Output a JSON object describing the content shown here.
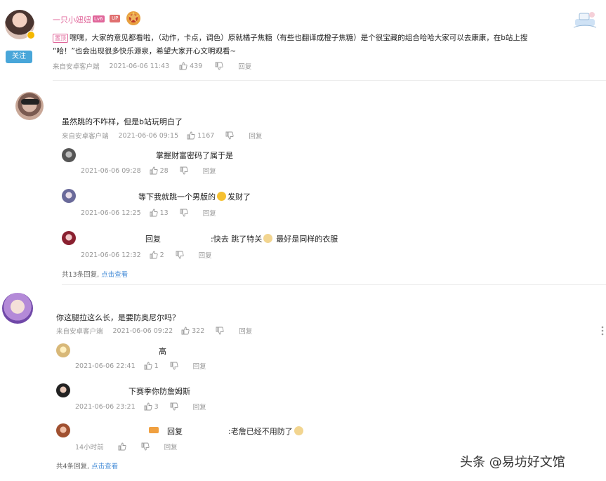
{
  "main": {
    "username": "一只小妞妞",
    "level_badge": "Lv6",
    "up_badge": "UP",
    "follow_label": "关注",
    "pinned_tag": "置顶",
    "content_line1": "嘿嘿，大家的意见都看啦，（动作，卡点，调色）原就橘子焦糖（有些也翻译成橙子焦糖）是个很宝藏的组合哈哈大家可以去康康，在b站上搜",
    "content_line2": "“哈！”也会出现很多快乐源泉，希望大家开心文明观看~",
    "source": "来自安卓客户端",
    "time": "2021-06-06 11:43",
    "likes": "439",
    "reply_label": "回复"
  },
  "comment1": {
    "text": "虽然跳的不咋样，但是b站玩明白了",
    "source": "来自安卓客户端",
    "time": "2021-06-06 09:15",
    "likes": "1167",
    "reply_label": "回复",
    "replies": [
      {
        "text": "掌握财富密码了属于是",
        "time": "2021-06-06 09:28",
        "likes": "28",
        "reply_label": "回复"
      },
      {
        "text_a": "等下我就跳一个男版的",
        "text_b": "发财了",
        "time": "2021-06-06 12:25",
        "likes": "13",
        "reply_label": "回复"
      },
      {
        "prefix": "回复",
        "text_a": ":快去  跳了特关",
        "text_b": "最好是同样的衣服",
        "time": "2021-06-06 12:32",
        "likes": "2",
        "reply_label": "回复"
      }
    ],
    "more_count": "共13条回复,",
    "more_link": "点击查看"
  },
  "comment2": {
    "text": "你这腿拉这么长，是要防奥尼尔吗？",
    "source": "来自安卓客户端",
    "time": "2021-06-06 09:22",
    "likes": "322",
    "reply_label": "回复",
    "replies": [
      {
        "text": "高",
        "time": "2021-06-06 22:41",
        "likes": "1",
        "reply_label": "回复"
      },
      {
        "text": "下赛季你防詹姆斯",
        "time": "2021-06-06 23:21",
        "likes": "3",
        "reply_label": "回复"
      },
      {
        "prefix": "回复",
        "text_a": ":老詹已经不用防了",
        "time": "14小时前",
        "reply_label": "回复"
      }
    ],
    "more_count": "共4条回复,",
    "more_link": "点击查看"
  },
  "watermark": "头条 @易坊好文馆",
  "colors": {
    "accent": "#4a8fd8",
    "pink": "#e0669a",
    "meta": "#999999",
    "follow_bg": "#48a6d9"
  }
}
